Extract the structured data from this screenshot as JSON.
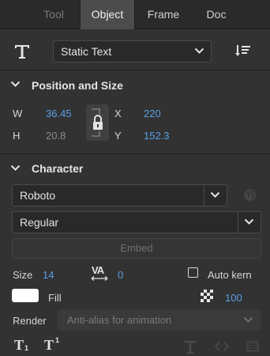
{
  "tabs": [
    {
      "label": "Tool"
    },
    {
      "label": "Object"
    },
    {
      "label": "Frame"
    },
    {
      "label": "Doc"
    }
  ],
  "text_type": {
    "selected": "Static Text"
  },
  "position_size": {
    "title": "Position and Size",
    "w_label": "W",
    "w_value": "36.45",
    "h_label": "H",
    "h_value": "20.8",
    "x_label": "X",
    "x_value": "220",
    "y_label": "Y",
    "y_value": "152.3"
  },
  "character": {
    "title": "Character",
    "font_family": "Roboto",
    "font_style": "Regular",
    "embed_label": "Embed",
    "size_label": "Size",
    "size_value": "14",
    "letter_spacing_glyph": "VA",
    "letter_spacing_value": "0",
    "auto_kern_label": "Auto kern",
    "fill_label": "Fill",
    "fill_color": "#ffffff",
    "alpha_value": "100",
    "render_label": "Render",
    "render_value": "Anti-alias for animation",
    "subscript_glyph": "T",
    "superscript_glyph": "T",
    "sub_mark": "1",
    "sup_mark": "1"
  },
  "colors": {
    "accent": "#5aa0e6",
    "panel_bg": "#323232"
  }
}
